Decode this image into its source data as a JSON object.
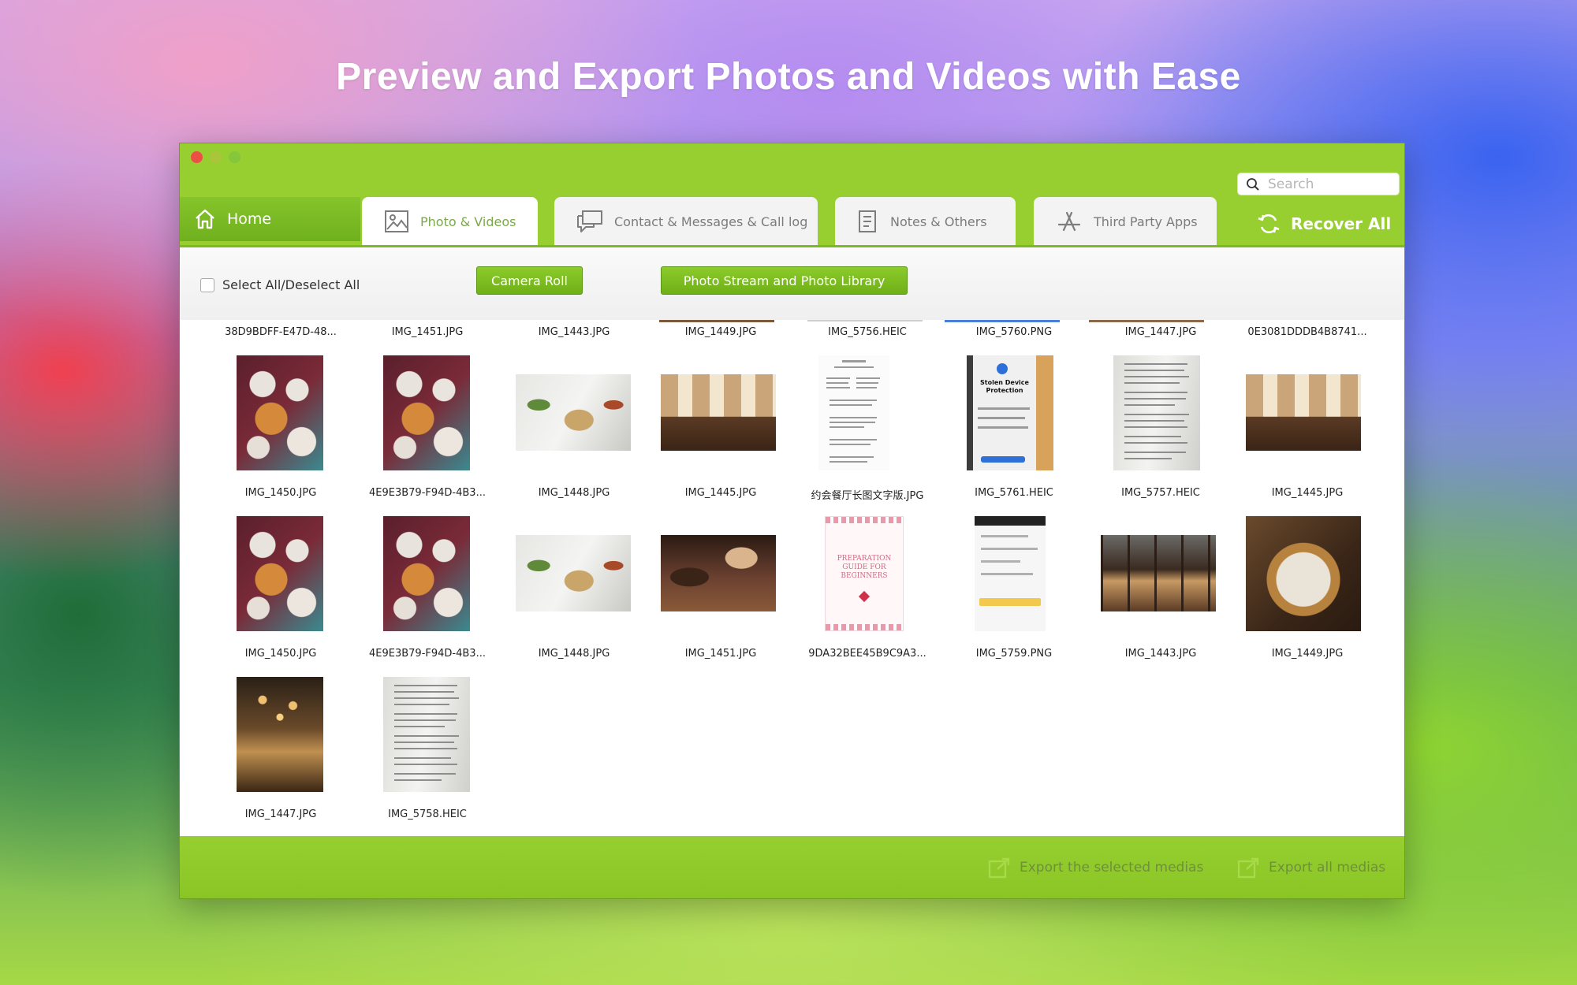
{
  "headline": "Preview and Export Photos and Videos with Ease",
  "search": {
    "placeholder": "Search"
  },
  "tabs": {
    "home": "Home",
    "photo": "Photo & Videos",
    "contact": "Contact & Messages & Call log",
    "notes": "Notes & Others",
    "third": "Third Party Apps",
    "recover": "Recover  All"
  },
  "toolbar": {
    "select_all": "Select All/Deselect All",
    "camera_roll": "Camera Roll",
    "photo_stream": "Photo Stream and Photo Library"
  },
  "row0": [
    "38D9BDFF-E47D-48...",
    "IMG_1451.JPG",
    "IMG_1443.JPG",
    "IMG_1449.JPG",
    "IMG_5756.HEIC",
    "IMG_5760.PNG",
    "IMG_1447.JPG",
    "0E3081DDDB4B8741..."
  ],
  "row1": [
    "IMG_1450.JPG",
    "4E9E3B79-F94D-4B3...",
    "IMG_1448.JPG",
    "IMG_1445.JPG",
    "约会餐厅长图文字版.JPG",
    "IMG_5761.HEIC",
    "IMG_5757.HEIC",
    "IMG_1445.JPG"
  ],
  "row2": [
    "IMG_1450.JPG",
    "4E9E3B79-F94D-4B3...",
    "IMG_1448.JPG",
    "IMG_1451.JPG",
    "9DA32BEE45B9C9A3...",
    "IMG_5759.PNG",
    "IMG_1443.JPG",
    "IMG_1449.JPG"
  ],
  "row3": [
    "IMG_1447.JPG",
    "IMG_5758.HEIC"
  ],
  "thumb_text": {
    "guide": [
      "PREPARATION",
      "GUIDE FOR",
      "BEGINNERS"
    ],
    "device": [
      "Stolen Device",
      "Protection"
    ]
  },
  "bottom": {
    "export_selected": "Export the selected medias",
    "export_all": "Export all medias"
  },
  "colors": {
    "accent": "#96cf2f",
    "button": "#7cbc22"
  }
}
